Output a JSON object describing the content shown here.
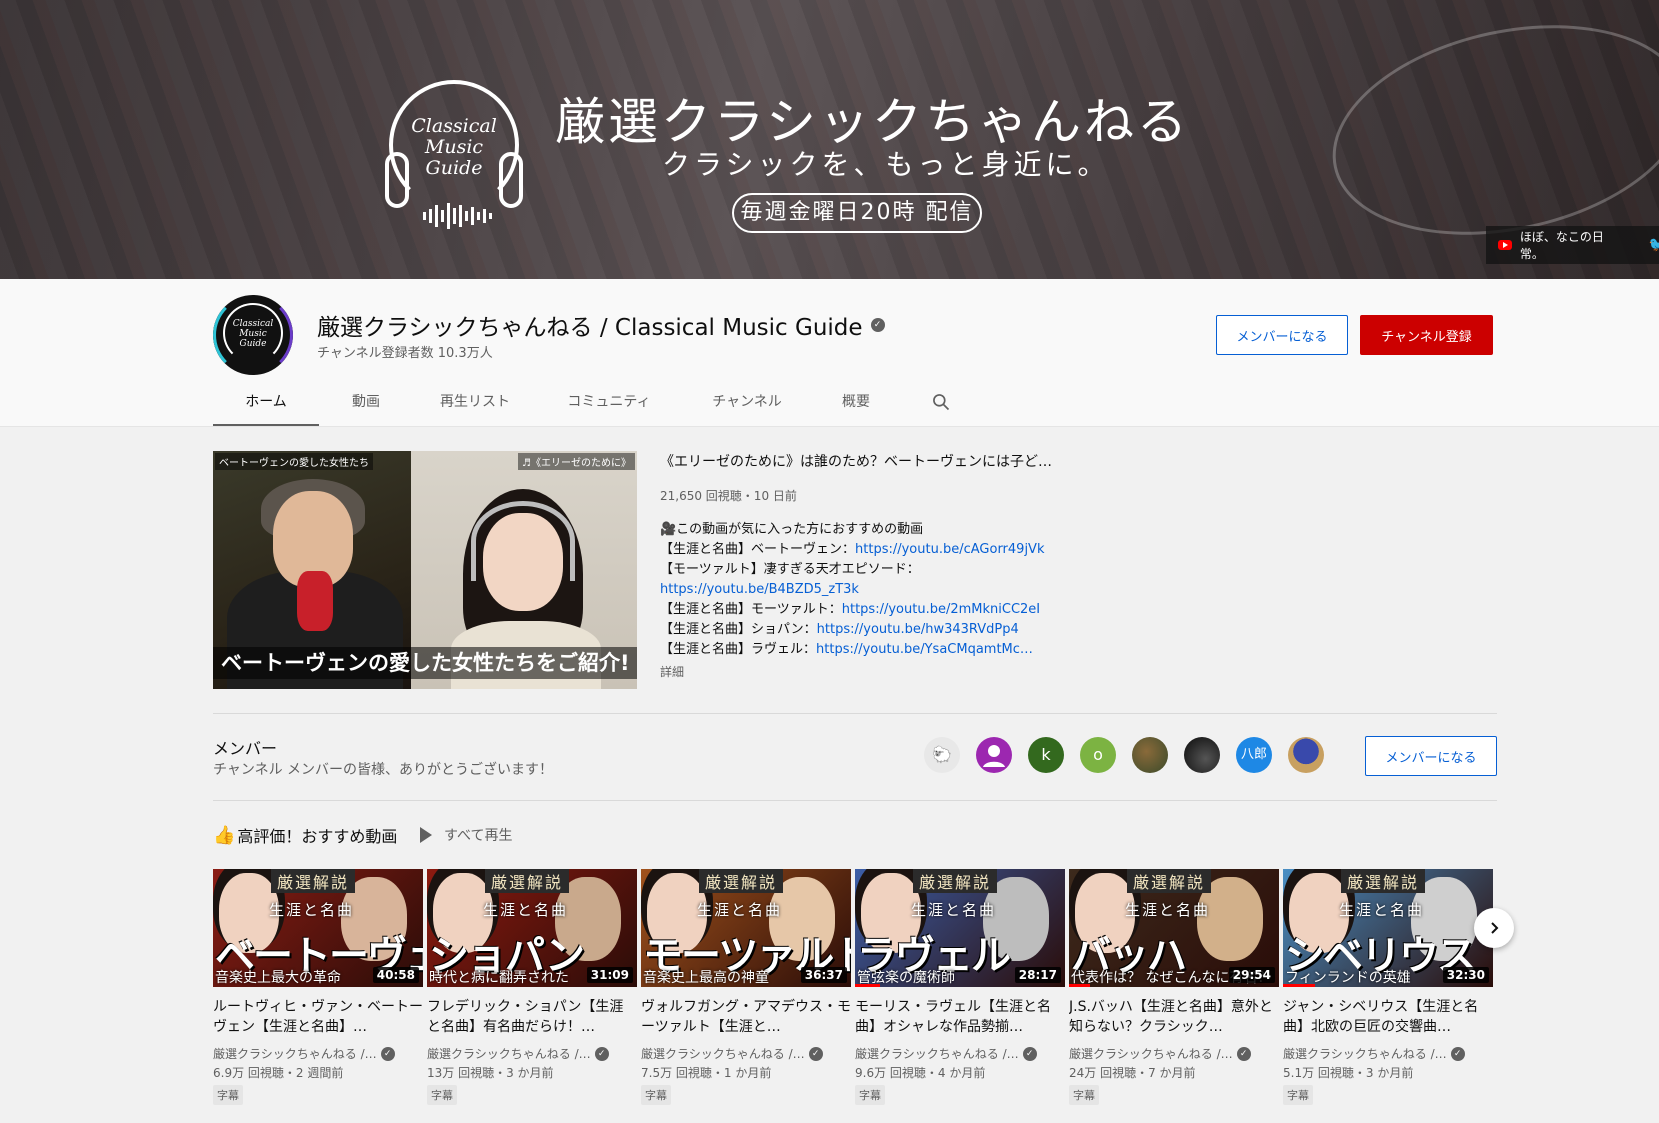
{
  "banner": {
    "logo_text": [
      "Classical",
      "Music",
      "Guide"
    ],
    "title": "厳選クラシックちゃんねる",
    "subtitle": "クラシックを、もっと身近に。",
    "schedule": "毎週金曜日20時 配信",
    "link_label": "ほぼ、なこの日常。"
  },
  "channel": {
    "avatar_text": [
      "Classical",
      "Music",
      "Guide"
    ],
    "name": "厳選クラシックちゃんねる / Classical Music Guide",
    "subscribers": "チャンネル登録者数 10.3万人",
    "member_button": "メンバーになる",
    "subscribe_button": "チャンネル登録"
  },
  "tabs": [
    {
      "label": "ホーム",
      "active": true
    },
    {
      "label": "動画"
    },
    {
      "label": "再生リスト"
    },
    {
      "label": "コミュニティ"
    },
    {
      "label": "チャンネル"
    },
    {
      "label": "概要"
    }
  ],
  "featured": {
    "thumb_tag_left": "ベートーヴェンの愛した女性たち",
    "thumb_tag_right": "♬《エリーゼのために》",
    "thumb_caption": "ベートーヴェンの愛した女性たちをご紹介!",
    "title": "《エリーゼのために》は誰のため？ベートーヴェンには子ど…",
    "meta": "21,650 回視聴・10 日前",
    "desc_lines": [
      {
        "text": "🎥この動画が気に入った方におすすめの動画",
        "link": ""
      },
      {
        "text": "【生涯と名曲】ベートーヴェン：",
        "link": "https://youtu.be/cAGorr49jVk"
      },
      {
        "text": "【モーツァルト】凄すぎる天才エピソード：",
        "link": ""
      },
      {
        "text": "",
        "link": "https://youtu.be/B4BZD5_zT3k"
      },
      {
        "text": "【生涯と名曲】モーツァルト：",
        "link": "https://youtu.be/2mMkniCC2eI"
      },
      {
        "text": "【生涯と名曲】ショパン：",
        "link": "https://youtu.be/hw343RVdPp4"
      },
      {
        "text": "【生涯と名曲】ラヴェル：",
        "link": "https://youtu.be/YsaCMqamtMc…"
      }
    ],
    "more": "詳細"
  },
  "members": {
    "title": "メンバー",
    "subtitle": "チャンネル メンバーの皆様、ありがとうございます！",
    "avatars": [
      {
        "letter": "",
        "color": "#e8e8e8",
        "icon": "sheep-avatar"
      },
      {
        "letter": "",
        "color": "#9c27b0",
        "icon": "person-avatar"
      },
      {
        "letter": "k",
        "color": "#33691e"
      },
      {
        "letter": "o",
        "color": "#7cb342"
      },
      {
        "letter": "",
        "color": "#4e5b3e",
        "icon": "photo-avatar"
      },
      {
        "letter": "",
        "color": "#111111",
        "icon": "piano-avatar"
      },
      {
        "letter": "八郎",
        "color": "#1e88e5"
      },
      {
        "letter": "",
        "color": "#5c6bc0",
        "icon": "umbrella-avatar"
      }
    ],
    "button": "メンバーになる"
  },
  "shelf": {
    "title": "高評価！おすすめ動画",
    "play_all": "すべて再生",
    "videos": [
      {
        "tag": "厳選解説",
        "life": "生涯と名曲",
        "big": "ベートーヴェン",
        "bottom": "音楽史上最大の革命",
        "duration": "40:58",
        "progress": 0,
        "bg": "#8b1d14",
        "composer": "#d8b49a",
        "title": "ルートヴィヒ・ヴァン・ベートーヴェン【生涯と名曲】…",
        "channel": "厳選クラシックちゃんねる /…",
        "meta": "6.9万 回視聴・2 週間前",
        "badge": "字幕"
      },
      {
        "tag": "厳選解説",
        "life": "生涯と名曲",
        "big": "ショパン",
        "bottom": "時代と病に翻弄された",
        "duration": "31:09",
        "progress": 0,
        "bg": "#8d1a10",
        "composer": "#c9a98c",
        "title": "フレデリック・ショパン【生涯と名曲】有名曲だらけ！…",
        "channel": "厳選クラシックちゃんねる /…",
        "meta": "13万 回視聴・3 か月前",
        "badge": "字幕"
      },
      {
        "tag": "厳選解説",
        "life": "生涯と名曲",
        "big": "モーツァルト",
        "bottom": "音楽史上最高の神童",
        "duration": "36:37",
        "progress": 0,
        "bg": "#a0521c",
        "composer": "#e6c7a8",
        "title": "ヴォルフガング・アマデウス・モーツァルト【生涯と…",
        "channel": "厳選クラシックちゃんねる /…",
        "meta": "7.5万 回視聴・1 か月前",
        "badge": "字幕"
      },
      {
        "tag": "厳選解説",
        "life": "生涯と名曲",
        "big": "ラヴェル",
        "bottom": "管弦楽の魔術師",
        "duration": "28:17",
        "progress": 0.12,
        "bg": "#3c5fa8",
        "composer": "#bdbdbd",
        "title": "モーリス・ラヴェル【生涯と名曲】オシャレな作品勢揃…",
        "channel": "厳選クラシックちゃんねる /…",
        "meta": "9.6万 回視聴・4 か月前",
        "badge": "字幕"
      },
      {
        "tag": "厳選解説",
        "life": "生涯と名曲",
        "big": "バッハ",
        "bottom": "代表作は？ なぜこんなに有名？",
        "duration": "29:54",
        "progress": 0.1,
        "bg": "#3d2a1c",
        "composer": "#d2b08a",
        "title": "J.S.バッハ【生涯と名曲】意外と知らない？クラシック…",
        "channel": "厳選クラシックちゃんねる /…",
        "meta": "24万 回視聴・7 か月前",
        "badge": "字幕"
      },
      {
        "tag": "厳選解説",
        "life": "生涯と名曲",
        "big": "シベリウス",
        "bottom": "フィンランドの英雄",
        "duration": "32:30",
        "progress": 0.15,
        "bg": "#4a8fc4",
        "composer": "#cfcfcf",
        "title": "ジャン・シベリウス【生涯と名曲】北欧の巨匠の交響曲…",
        "channel": "厳選クラシックちゃんねる /…",
        "meta": "5.1万 回視聴・3 か月前",
        "badge": "字幕"
      }
    ]
  },
  "colors": {
    "subscribe": "#cc0000",
    "link": "#065fd4",
    "secondary_text": "#606060"
  }
}
